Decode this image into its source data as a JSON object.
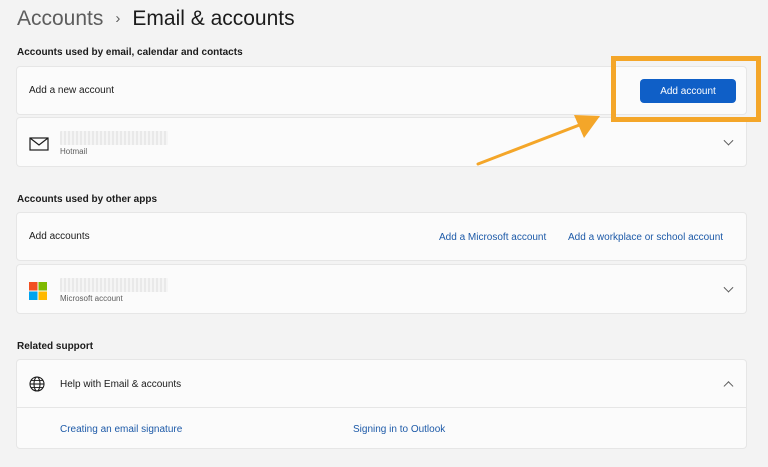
{
  "breadcrumb": {
    "parent": "Accounts",
    "separator": "›",
    "current": "Email & accounts"
  },
  "email_section": {
    "title": "Accounts used by email, calendar and contacts",
    "add_row": {
      "label": "Add a new account",
      "button": "Add account"
    },
    "account": {
      "type_label": "Hotmail",
      "icon": "mail-icon"
    }
  },
  "other_apps_section": {
    "title": "Accounts used by other apps",
    "add_row": {
      "label": "Add accounts",
      "link_microsoft": "Add a Microsoft account",
      "link_work": "Add a workplace or school account"
    },
    "account": {
      "type_label": "Microsoft account",
      "icon": "microsoft-logo"
    }
  },
  "related_support": {
    "title": "Related support",
    "help_item": {
      "label": "Help with Email & accounts",
      "icon": "globe-icon"
    },
    "links": [
      "Creating an email signature",
      "Signing in to Outlook"
    ]
  },
  "colors": {
    "accent": "#0f5fc7",
    "highlight": "#f4a629",
    "link": "#1d5aa8"
  }
}
